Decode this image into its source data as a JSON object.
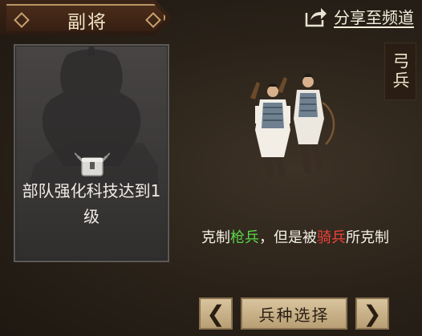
{
  "header": {
    "title": "副将",
    "share_label": "分享至频道"
  },
  "locked_slot": {
    "icon": "lock-icon",
    "requirement_text": "部队强化科技达到1级"
  },
  "unit": {
    "type_label": "弓兵",
    "description": {
      "prefix": "克制",
      "strong_against": "枪兵",
      "middle": "，但是被",
      "weak_against": "骑兵",
      "suffix": "所克制"
    }
  },
  "footer": {
    "prev_label": "❮",
    "select_label": "兵种选择",
    "next_label": "❯"
  },
  "colors": {
    "strong": "#56d648",
    "weak": "#f0423a"
  }
}
